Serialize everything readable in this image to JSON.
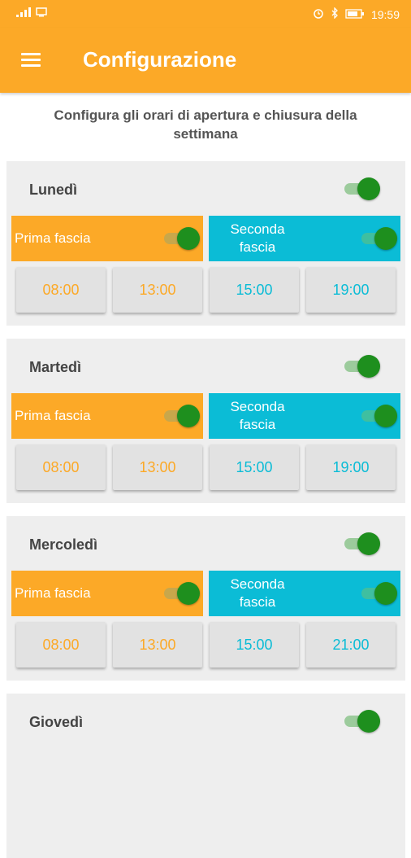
{
  "colors": {
    "accent": "#FCA927",
    "secondary": "#0BBCD6",
    "toggle_on": "#1e8f1e"
  },
  "status": {
    "time": "19:59",
    "left_icons": [
      "signal-icon",
      "cast-icon"
    ],
    "right_icons": [
      "alarm-icon",
      "bluetooth-icon",
      "battery-icon"
    ]
  },
  "appbar": {
    "title": "Configurazione",
    "menu_icon": "menu-icon"
  },
  "intro": "Configura gli orari di apertura e chiusura della settimana",
  "labels": {
    "first": "Prima fascia",
    "second": "Seconda fascia"
  },
  "days": [
    {
      "name": "Lunedì",
      "enabled": true,
      "first_enabled": true,
      "second_enabled": true,
      "times": [
        "08:00",
        "13:00",
        "15:00",
        "19:00"
      ]
    },
    {
      "name": "Martedì",
      "enabled": true,
      "first_enabled": true,
      "second_enabled": true,
      "times": [
        "08:00",
        "13:00",
        "15:00",
        "19:00"
      ]
    },
    {
      "name": "Mercoledì",
      "enabled": true,
      "first_enabled": true,
      "second_enabled": true,
      "times": [
        "08:00",
        "13:00",
        "15:00",
        "21:00"
      ]
    },
    {
      "name": "Giovedì",
      "enabled": true
    }
  ]
}
